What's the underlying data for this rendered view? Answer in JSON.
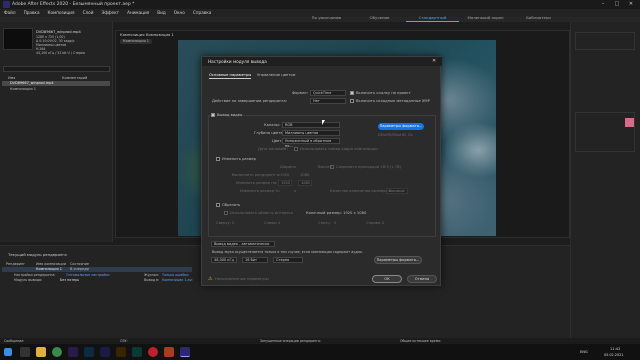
{
  "titlebar": {
    "title": "Adobe After Effects 2020 - Безымянный проект.aep *"
  },
  "menu": [
    "Файл",
    "Правка",
    "Композиция",
    "Слой",
    "Эффект",
    "Анимация",
    "Вид",
    "Окно",
    "Справка"
  ],
  "workspaces": [
    "По умолчанию",
    "Обучение",
    "Стандартный",
    "Маленький экран",
    "Библиотеки"
  ],
  "workspace_active": 2,
  "project": {
    "item_name": "DVD89667_winprod.mp4",
    "info_lines": [
      "1280 x 720 (1,00)",
      "Δ 0:10:09:02, 30 кадр/с",
      "Миллионы цветов",
      "H.264",
      "44,100 кГц / 32 bit U / Стерео"
    ],
    "col_name": "Имя",
    "col_comment": "Комментарий",
    "rows": [
      "DVD89667_winprod.mp4",
      "Композиция 1"
    ]
  },
  "viewer": {
    "tab": "Композиция Композиция 1",
    "breadcrumb": "Композиция 1"
  },
  "dialog": {
    "title": "Настройки модуля вывода",
    "tabs": [
      "Основные параметры",
      "Управление цветом"
    ],
    "format_label": "Формат:",
    "format_value": "QuickTime",
    "post_render_label": "Действие по завершении рендеринга:",
    "post_render_value": "Нет",
    "include_project_link": "Включить ссылку на проект",
    "include_xmp": "Включить исходные метаданные XMP",
    "video_output": "Вывод видео",
    "channels_label": "Каналы:",
    "channels_value": "RGB",
    "depth_label": "Глубина цвета:",
    "depth_value": "Миллионы цветов",
    "color_label": "Цвет:",
    "color_value": "Умноженный в обратном по...",
    "start_label": "Дата начала #:",
    "start_value": "0",
    "use_comp_frame": "Использовать номер кадра композиции",
    "format_options_btn": "Параметры формата...",
    "codec_info": "DNxHR/DNxHD, 0x",
    "resize": "Изменить размер",
    "width_label": "Ширина",
    "height_label": "Высота",
    "lock_aspect": "Сохранить пропорции 16:9 (1,78)",
    "rendering_in": "Выполнить рендеринг в:",
    "render_w": "1920",
    "render_h": "1080",
    "resize_to": "Изменить размер на:",
    "resize_w": "1920",
    "resize_h": "1080",
    "resize_pct": "Изменить размер %:",
    "pct_x": "x",
    "resize_quality": "Качество изменения размеров:",
    "quality_value": "Высокое",
    "crop": "Обрезать",
    "use_roi": "Использовать область интереса",
    "final_size": "Конечный размер: 1920 x 1080",
    "top": "Сверху:",
    "left": "Слева:",
    "bottom": "Снизу:",
    "right": "Справа:",
    "crop_top": "0",
    "crop_left": "0",
    "crop_bottom": "0",
    "crop_right": "0",
    "audio_output": "Вывод видео - автоматически",
    "audio_note": "Вывод звука осуществляется только в том случае, если композиция содержит аудио.",
    "audio_rate": "48,000 кГц",
    "audio_bits": "16 бит",
    "audio_ch": "Стерео",
    "audio_format_btn": "Параметры формата...",
    "warning": "Несохраненные параметры",
    "ok": "ОК",
    "cancel": "Отмена"
  },
  "timeline": {
    "tab": "Текущий модуль рендеринга",
    "render_label": "Рендеринг",
    "comp_label": "Имя композиции",
    "status_label": "Состояние",
    "status_value": "В очереди",
    "row_name": "Композиция 1",
    "settings_label": "Настройки рендеринга:",
    "settings_value": "Оптимальные настройки",
    "output_module_label": "Модуль вывода:",
    "output_module_value": "Без потерь",
    "format_label": "Журнал:",
    "format_value": "Только ошибки",
    "output_to_label": "Вывод в:",
    "output_to_value": "Композиция 1.avi"
  },
  "statusbar": {
    "left": "Сообщение:",
    "ram": "ОЗУ:",
    "renders": "Запущенные операции рендеринга:",
    "elapsed": "Общее истекшее время:"
  },
  "taskbar": {
    "time": "11:42",
    "date": "05.02.2021",
    "lang": "ENG"
  },
  "colors": {
    "accent": "#1473e6",
    "workspace_active": "#5ea0ff",
    "ae_icon": "#2c2a6b"
  }
}
